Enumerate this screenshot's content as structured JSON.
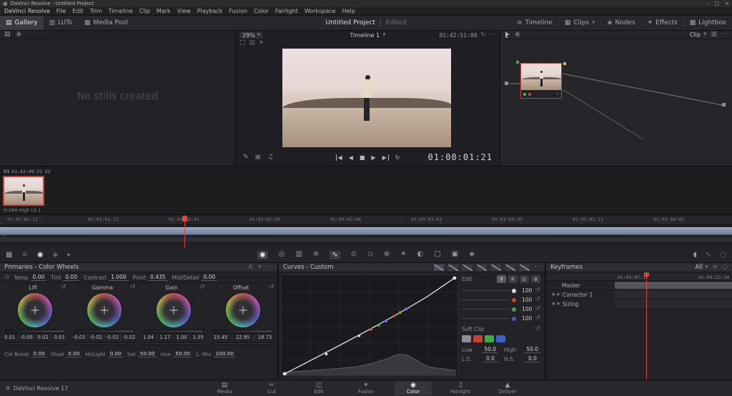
{
  "colors": {
    "accent_red": "#e04238",
    "clip_bar_blue": "#7e90a6",
    "dot_y": "#d8d8d8",
    "dot_r": "#c84038",
    "dot_g": "#40a840",
    "dot_b": "#4060c8"
  },
  "icons": {
    "app": "▣",
    "minimize": "–",
    "maximize": "□",
    "close": "×",
    "gallery": "▤",
    "luts": "▥",
    "media_pool": "▦",
    "timeline": "≡",
    "clips": "▦",
    "nodes": "◈",
    "effects": "✴",
    "lightbox": "▩",
    "chevron": "▾",
    "more": "⋯",
    "pen": "✎",
    "compare": "▣",
    "audio": "♫",
    "step_back": "◀",
    "stop": "■",
    "play": "▶",
    "loop": "↻",
    "reset": "↺",
    "home": "⌂",
    "auto": "A",
    "magic": "✴",
    "wheel": "◉",
    "hdr": "◎",
    "mixer": "▥",
    "motion": "≋",
    "curve": "∿",
    "qualifier": "⊙",
    "window": "◇",
    "tracker": "⊕",
    "blur": "◐",
    "key": "□",
    "sizing": "▣",
    "stereo": "◈",
    "scopes": "◖",
    "info": "○",
    "still": "▤",
    "grab": "◉",
    "pointer": "➢",
    "dotgrid": "·",
    "page_media": "▤",
    "page_cut": "✂",
    "page_edit": "◫",
    "page_fusion": "✴",
    "page_color": "◉",
    "page_fairlight": "♫",
    "page_deliver": "▲",
    "expand": "▸",
    "bullet": "●"
  },
  "titlebar": {
    "title": "DaVinci Resolve - Untitled Project"
  },
  "menubar": {
    "items": [
      "DaVinci Resolve",
      "File",
      "Edit",
      "Trim",
      "Timeline",
      "Clip",
      "Mark",
      "View",
      "Playback",
      "Fusion",
      "Color",
      "Fairlight",
      "Workspace",
      "Help"
    ]
  },
  "topbar": {
    "gallery": "Gallery",
    "luts": "LUTs",
    "media_pool": "Media Pool",
    "project_title": "Untitled Project",
    "project_status": "Edited",
    "timeline": "Timeline",
    "clips": "Clips",
    "nodes": "Nodes",
    "effects": "Effects",
    "lightbox": "Lightbox"
  },
  "gallery": {
    "empty_text": "No stills created"
  },
  "viewer": {
    "zoom": "29%",
    "timeline_name": "Timeline 1",
    "tc_source": "01:42:51:08",
    "tc_playhead": "01:00:01:21"
  },
  "nodes_panel": {
    "mode": "Clip"
  },
  "clip": {
    "index": "01",
    "timecode": "01:42:49:21",
    "version": "V2",
    "codec": "H.264 High L5.1"
  },
  "timeline": {
    "ticks": [
      "01:03:01:21",
      "01:03:01:23",
      "01:03:02:01",
      "01:03:02:03",
      "01:03:02:04",
      "01:03:03:03",
      "01:03:03:05",
      "01:03:03:21",
      "01:03:04:01"
    ],
    "tracks": [
      "v3",
      "v2",
      "v1"
    ]
  },
  "primaries": {
    "title": "Primaries - Color Wheels",
    "top_params": [
      {
        "label": "Temp",
        "value": "0.00"
      },
      {
        "label": "Tint",
        "value": "0.00"
      },
      {
        "label": "Contrast",
        "value": "1.000"
      },
      {
        "label": "Pivot",
        "value": "0.435"
      },
      {
        "label": "Mid/Detail",
        "value": "0.00"
      }
    ],
    "wheels": [
      {
        "name": "Lift",
        "values": [
          "0.01",
          "-0.00",
          "0.02",
          "0.01"
        ]
      },
      {
        "name": "Gamma",
        "values": [
          "-0.02",
          "-0.02",
          "-0.02",
          "-0.02"
        ]
      },
      {
        "name": "Gain",
        "values": [
          "1.04",
          "1.17",
          "1.00",
          "1.05"
        ]
      },
      {
        "name": "Offset",
        "values": [
          "15.45",
          "22.95",
          "18.73"
        ]
      }
    ],
    "bottom_params": [
      {
        "label": "Col Boost",
        "value": "0.00"
      },
      {
        "label": "Shad",
        "value": "0.00"
      },
      {
        "label": "Hi/Light",
        "value": "0.00"
      },
      {
        "label": "Sat",
        "value": "50.00"
      },
      {
        "label": "Hue",
        "value": "50.00"
      },
      {
        "label": "L. Mix",
        "value": "100.00"
      }
    ]
  },
  "curves": {
    "title": "Curves - Custom",
    "edit_label": "Edit",
    "channels": [
      "Y",
      "R",
      "G",
      "B"
    ],
    "rows": [
      {
        "value": "100"
      },
      {
        "value": "100"
      },
      {
        "value": "100"
      },
      {
        "value": "100"
      }
    ],
    "soft_clip_label": "Soft Clip",
    "params": [
      {
        "label": "Low",
        "value": "50.0"
      },
      {
        "label": "High",
        "value": "50.0"
      },
      {
        "label": "L.S.",
        "value": "0.0"
      },
      {
        "label": "H.S.",
        "value": "0.0"
      }
    ]
  },
  "keyframes": {
    "title": "Keyframes",
    "filter_all": "All",
    "tc_left": "01:03:07:17",
    "tc_right": "01:03:23:14",
    "rows": [
      "Master",
      "Corrector 1",
      "Sizing"
    ]
  },
  "bottombar": {
    "version": "DaVinci Resolve 17",
    "pages": [
      "Media",
      "Cut",
      "Edit",
      "Fusion",
      "Color",
      "Fairlight",
      "Deliver"
    ]
  }
}
